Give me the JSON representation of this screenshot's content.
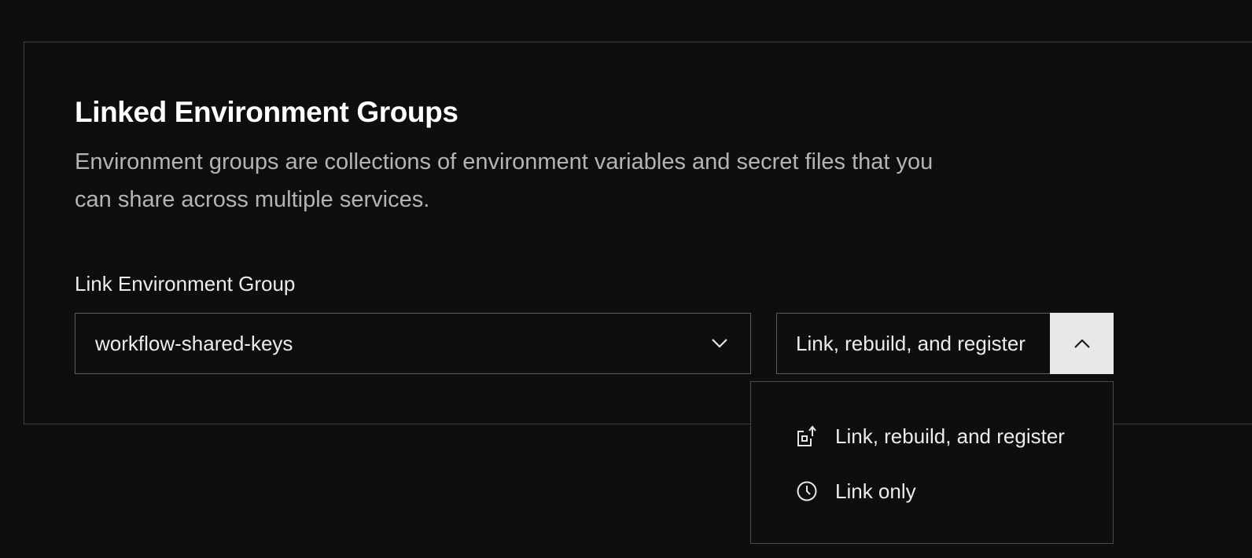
{
  "section": {
    "title": "Linked Environment Groups",
    "description": "Environment groups are collections of environment variables and secret files that you can share across multiple services."
  },
  "link_group": {
    "label": "Link Environment Group",
    "selected_value": "workflow-shared-keys"
  },
  "action_button": {
    "label": "Link, rebuild, and register"
  },
  "action_menu": {
    "items": [
      {
        "label": "Link, rebuild, and register",
        "icon": "link-rebuild-icon"
      },
      {
        "label": "Link only",
        "icon": "clock-icon"
      }
    ]
  },
  "colors": {
    "background": "#0e0e0e",
    "border": "#5c5c5c",
    "toggle_bg": "#e8e8e8",
    "text_primary": "#ffffff",
    "text_secondary": "#b4b4b4"
  }
}
